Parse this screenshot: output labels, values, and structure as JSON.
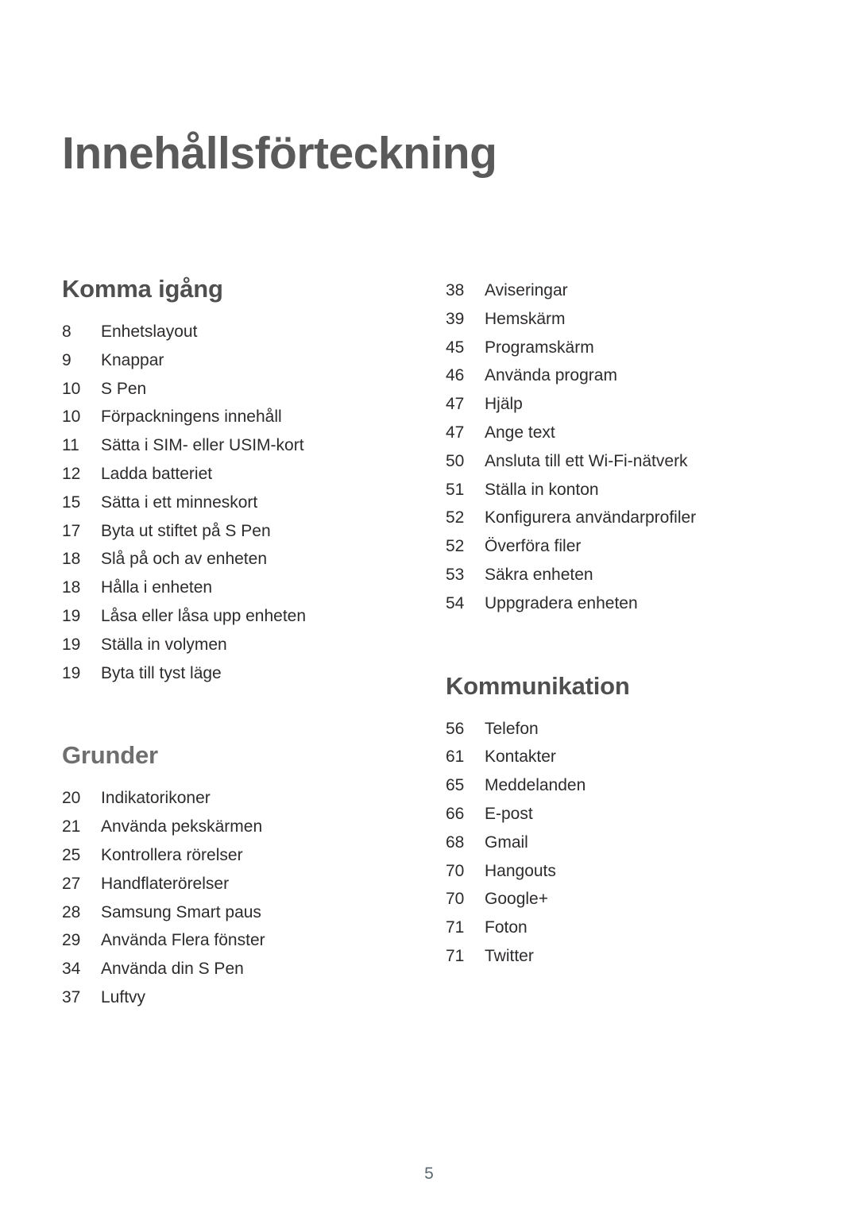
{
  "document": {
    "title": "Innehållsförteckning",
    "page_number": "5"
  },
  "colors": {
    "title": "#5a5a5a",
    "heading_dark": "#4f4f4f",
    "heading_light": "#6f6f6f",
    "body_text": "#2e2b2c",
    "page_number": "#5b6a70",
    "background": "#ffffff"
  },
  "left_column": {
    "sections": [
      {
        "heading": "Komma igång",
        "heading_color": "#4f4f4f",
        "entries": [
          {
            "page": "8",
            "label": "Enhetslayout"
          },
          {
            "page": "9",
            "label": "Knappar"
          },
          {
            "page": "10",
            "label": "S Pen"
          },
          {
            "page": "10",
            "label": "Förpackningens innehåll"
          },
          {
            "page": "11",
            "label": "Sätta i SIM- eller USIM-kort"
          },
          {
            "page": "12",
            "label": "Ladda batteriet"
          },
          {
            "page": "15",
            "label": "Sätta i ett minneskort"
          },
          {
            "page": "17",
            "label": "Byta ut stiftet på S Pen"
          },
          {
            "page": "18",
            "label": "Slå på och av enheten"
          },
          {
            "page": "18",
            "label": "Hålla i enheten"
          },
          {
            "page": "19",
            "label": "Låsa eller låsa upp enheten"
          },
          {
            "page": "19",
            "label": "Ställa in volymen"
          },
          {
            "page": "19",
            "label": "Byta till tyst läge"
          }
        ]
      },
      {
        "heading": "Grunder",
        "heading_color": "#6f6f6f",
        "entries": [
          {
            "page": "20",
            "label": "Indikatorikoner"
          },
          {
            "page": "21",
            "label": "Använda pekskärmen"
          },
          {
            "page": "25",
            "label": "Kontrollera rörelser"
          },
          {
            "page": "27",
            "label": "Handflaterörelser"
          },
          {
            "page": "28",
            "label": "Samsung Smart paus"
          },
          {
            "page": "29",
            "label": "Använda Flera fönster"
          },
          {
            "page": "34",
            "label": "Använda din S Pen"
          },
          {
            "page": "37",
            "label": "Luftvy"
          }
        ]
      }
    ]
  },
  "right_column": {
    "sections": [
      {
        "heading": "",
        "heading_color": "#4f4f4f",
        "entries": [
          {
            "page": "38",
            "label": "Aviseringar"
          },
          {
            "page": "39",
            "label": "Hemskärm"
          },
          {
            "page": "45",
            "label": "Programskärm"
          },
          {
            "page": "46",
            "label": "Använda program"
          },
          {
            "page": "47",
            "label": "Hjälp"
          },
          {
            "page": "47",
            "label": "Ange text"
          },
          {
            "page": "50",
            "label": "Ansluta till ett Wi-Fi-nätverk"
          },
          {
            "page": "51",
            "label": "Ställa in konton"
          },
          {
            "page": "52",
            "label": "Konfigurera användarprofiler"
          },
          {
            "page": "52",
            "label": "Överföra filer"
          },
          {
            "page": "53",
            "label": "Säkra enheten"
          },
          {
            "page": "54",
            "label": "Uppgradera enheten"
          }
        ]
      },
      {
        "heading": "Kommunikation",
        "heading_color": "#4f4f4f",
        "entries": [
          {
            "page": "56",
            "label": "Telefon"
          },
          {
            "page": "61",
            "label": "Kontakter"
          },
          {
            "page": "65",
            "label": "Meddelanden"
          },
          {
            "page": "66",
            "label": "E-post"
          },
          {
            "page": "68",
            "label": "Gmail"
          },
          {
            "page": "70",
            "label": "Hangouts"
          },
          {
            "page": "70",
            "label": "Google+"
          },
          {
            "page": "71",
            "label": "Foton"
          },
          {
            "page": "71",
            "label": "Twitter"
          }
        ]
      }
    ]
  }
}
